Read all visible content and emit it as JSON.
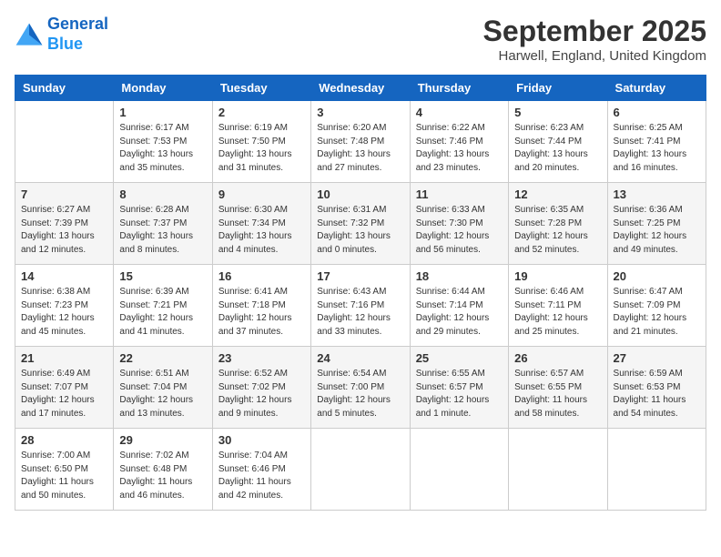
{
  "header": {
    "logo_line1": "General",
    "logo_line2": "Blue",
    "month": "September 2025",
    "location": "Harwell, England, United Kingdom"
  },
  "weekdays": [
    "Sunday",
    "Monday",
    "Tuesday",
    "Wednesday",
    "Thursday",
    "Friday",
    "Saturday"
  ],
  "weeks": [
    [
      {
        "day": "",
        "sunrise": "",
        "sunset": "",
        "daylight": ""
      },
      {
        "day": "1",
        "sunrise": "Sunrise: 6:17 AM",
        "sunset": "Sunset: 7:53 PM",
        "daylight": "Daylight: 13 hours and 35 minutes."
      },
      {
        "day": "2",
        "sunrise": "Sunrise: 6:19 AM",
        "sunset": "Sunset: 7:50 PM",
        "daylight": "Daylight: 13 hours and 31 minutes."
      },
      {
        "day": "3",
        "sunrise": "Sunrise: 6:20 AM",
        "sunset": "Sunset: 7:48 PM",
        "daylight": "Daylight: 13 hours and 27 minutes."
      },
      {
        "day": "4",
        "sunrise": "Sunrise: 6:22 AM",
        "sunset": "Sunset: 7:46 PM",
        "daylight": "Daylight: 13 hours and 23 minutes."
      },
      {
        "day": "5",
        "sunrise": "Sunrise: 6:23 AM",
        "sunset": "Sunset: 7:44 PM",
        "daylight": "Daylight: 13 hours and 20 minutes."
      },
      {
        "day": "6",
        "sunrise": "Sunrise: 6:25 AM",
        "sunset": "Sunset: 7:41 PM",
        "daylight": "Daylight: 13 hours and 16 minutes."
      }
    ],
    [
      {
        "day": "7",
        "sunrise": "Sunrise: 6:27 AM",
        "sunset": "Sunset: 7:39 PM",
        "daylight": "Daylight: 13 hours and 12 minutes."
      },
      {
        "day": "8",
        "sunrise": "Sunrise: 6:28 AM",
        "sunset": "Sunset: 7:37 PM",
        "daylight": "Daylight: 13 hours and 8 minutes."
      },
      {
        "day": "9",
        "sunrise": "Sunrise: 6:30 AM",
        "sunset": "Sunset: 7:34 PM",
        "daylight": "Daylight: 13 hours and 4 minutes."
      },
      {
        "day": "10",
        "sunrise": "Sunrise: 6:31 AM",
        "sunset": "Sunset: 7:32 PM",
        "daylight": "Daylight: 13 hours and 0 minutes."
      },
      {
        "day": "11",
        "sunrise": "Sunrise: 6:33 AM",
        "sunset": "Sunset: 7:30 PM",
        "daylight": "Daylight: 12 hours and 56 minutes."
      },
      {
        "day": "12",
        "sunrise": "Sunrise: 6:35 AM",
        "sunset": "Sunset: 7:28 PM",
        "daylight": "Daylight: 12 hours and 52 minutes."
      },
      {
        "day": "13",
        "sunrise": "Sunrise: 6:36 AM",
        "sunset": "Sunset: 7:25 PM",
        "daylight": "Daylight: 12 hours and 49 minutes."
      }
    ],
    [
      {
        "day": "14",
        "sunrise": "Sunrise: 6:38 AM",
        "sunset": "Sunset: 7:23 PM",
        "daylight": "Daylight: 12 hours and 45 minutes."
      },
      {
        "day": "15",
        "sunrise": "Sunrise: 6:39 AM",
        "sunset": "Sunset: 7:21 PM",
        "daylight": "Daylight: 12 hours and 41 minutes."
      },
      {
        "day": "16",
        "sunrise": "Sunrise: 6:41 AM",
        "sunset": "Sunset: 7:18 PM",
        "daylight": "Daylight: 12 hours and 37 minutes."
      },
      {
        "day": "17",
        "sunrise": "Sunrise: 6:43 AM",
        "sunset": "Sunset: 7:16 PM",
        "daylight": "Daylight: 12 hours and 33 minutes."
      },
      {
        "day": "18",
        "sunrise": "Sunrise: 6:44 AM",
        "sunset": "Sunset: 7:14 PM",
        "daylight": "Daylight: 12 hours and 29 minutes."
      },
      {
        "day": "19",
        "sunrise": "Sunrise: 6:46 AM",
        "sunset": "Sunset: 7:11 PM",
        "daylight": "Daylight: 12 hours and 25 minutes."
      },
      {
        "day": "20",
        "sunrise": "Sunrise: 6:47 AM",
        "sunset": "Sunset: 7:09 PM",
        "daylight": "Daylight: 12 hours and 21 minutes."
      }
    ],
    [
      {
        "day": "21",
        "sunrise": "Sunrise: 6:49 AM",
        "sunset": "Sunset: 7:07 PM",
        "daylight": "Daylight: 12 hours and 17 minutes."
      },
      {
        "day": "22",
        "sunrise": "Sunrise: 6:51 AM",
        "sunset": "Sunset: 7:04 PM",
        "daylight": "Daylight: 12 hours and 13 minutes."
      },
      {
        "day": "23",
        "sunrise": "Sunrise: 6:52 AM",
        "sunset": "Sunset: 7:02 PM",
        "daylight": "Daylight: 12 hours and 9 minutes."
      },
      {
        "day": "24",
        "sunrise": "Sunrise: 6:54 AM",
        "sunset": "Sunset: 7:00 PM",
        "daylight": "Daylight: 12 hours and 5 minutes."
      },
      {
        "day": "25",
        "sunrise": "Sunrise: 6:55 AM",
        "sunset": "Sunset: 6:57 PM",
        "daylight": "Daylight: 12 hours and 1 minute."
      },
      {
        "day": "26",
        "sunrise": "Sunrise: 6:57 AM",
        "sunset": "Sunset: 6:55 PM",
        "daylight": "Daylight: 11 hours and 58 minutes."
      },
      {
        "day": "27",
        "sunrise": "Sunrise: 6:59 AM",
        "sunset": "Sunset: 6:53 PM",
        "daylight": "Daylight: 11 hours and 54 minutes."
      }
    ],
    [
      {
        "day": "28",
        "sunrise": "Sunrise: 7:00 AM",
        "sunset": "Sunset: 6:50 PM",
        "daylight": "Daylight: 11 hours and 50 minutes."
      },
      {
        "day": "29",
        "sunrise": "Sunrise: 7:02 AM",
        "sunset": "Sunset: 6:48 PM",
        "daylight": "Daylight: 11 hours and 46 minutes."
      },
      {
        "day": "30",
        "sunrise": "Sunrise: 7:04 AM",
        "sunset": "Sunset: 6:46 PM",
        "daylight": "Daylight: 11 hours and 42 minutes."
      },
      {
        "day": "",
        "sunrise": "",
        "sunset": "",
        "daylight": ""
      },
      {
        "day": "",
        "sunrise": "",
        "sunset": "",
        "daylight": ""
      },
      {
        "day": "",
        "sunrise": "",
        "sunset": "",
        "daylight": ""
      },
      {
        "day": "",
        "sunrise": "",
        "sunset": "",
        "daylight": ""
      }
    ]
  ]
}
